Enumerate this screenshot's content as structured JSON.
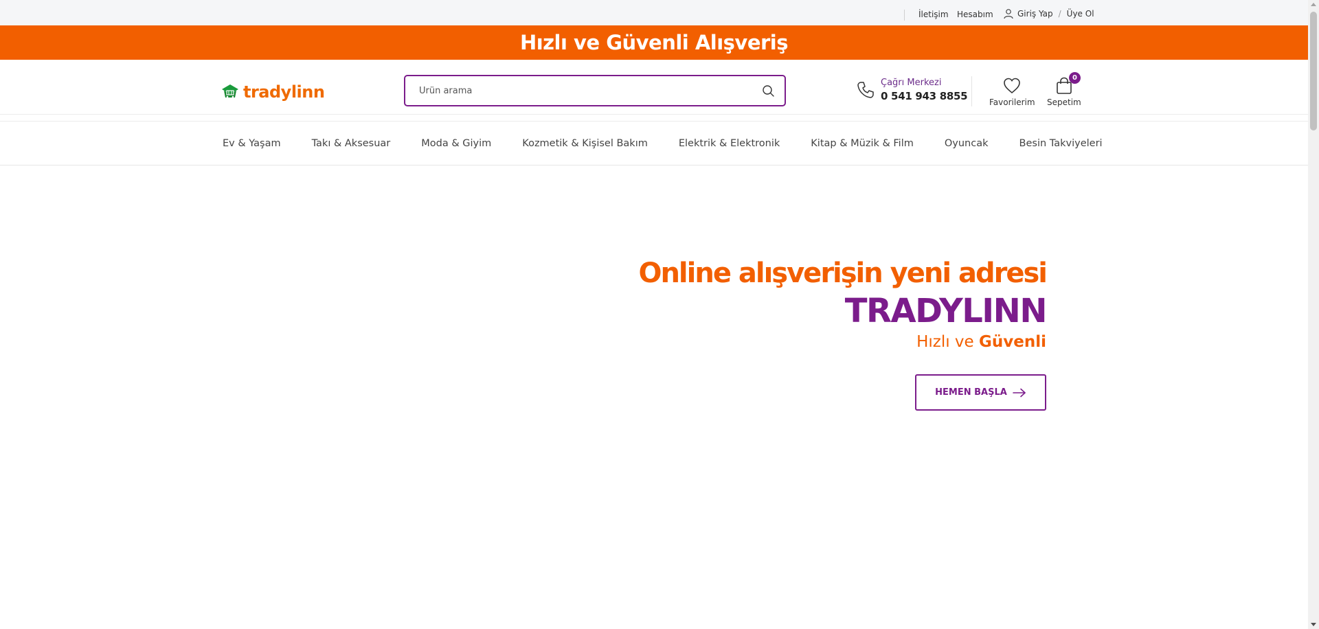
{
  "topbar": {
    "contact_label": "İletişim",
    "account_label": "Hesabım",
    "login_label": "Giriş Yap",
    "login_separator": "/",
    "register_label": "Üye Ol",
    "user_icon": "user-icon"
  },
  "banner": {
    "title": "Hızlı ve Güvenli Alışveriş",
    "color": "#f25f00"
  },
  "header": {
    "logo_text": "tradylinn",
    "search": {
      "placeholder": "Ürün arama",
      "value": "",
      "icon": "search-icon"
    },
    "call_center": {
      "label": "Çağrı Merkezi",
      "number": "0 541 943 8855",
      "icon": "phone-icon"
    },
    "favorites_label": "Favorilerim",
    "cart_label": "Sepetim",
    "cart_count": "0"
  },
  "nav": {
    "items": [
      {
        "label": "Ev & Yaşam"
      },
      {
        "label": "Takı & Aksesuar"
      },
      {
        "label": "Moda & Giyim"
      },
      {
        "label": "Kozmetik & Kişisel Bakım"
      },
      {
        "label": "Elektrik & Elektronik"
      },
      {
        "label": "Kitap & Müzik & Film"
      },
      {
        "label": "Oyuncak"
      },
      {
        "label": "Besin Takviyeleri"
      }
    ]
  },
  "hero": {
    "line1": "Online alışverişin yeni adresi",
    "line2": "TRADYLINN",
    "line3_prefix": "Hızlı ve",
    "line3_bold": "Güvenli",
    "cta_label": "HEMEN BAŞLA",
    "cta_icon": "arrow-right-icon"
  },
  "colors": {
    "brand_orange": "#f25f00",
    "brand_purple": "#7b1c8b",
    "logo_green": "#1a9b3c"
  }
}
